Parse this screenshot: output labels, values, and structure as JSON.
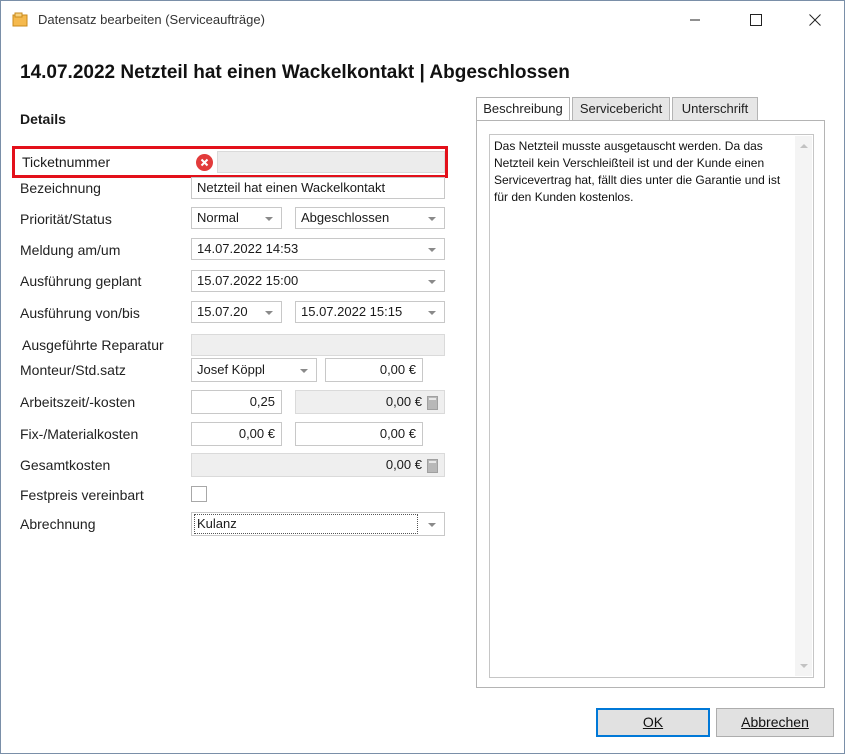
{
  "window": {
    "title": "Datensatz bearbeiten (Serviceaufträge)"
  },
  "headline": "14.07.2022 Netzteil hat einen Wackelkontakt | Abgeschlossen",
  "details": {
    "section_title": "Details",
    "ticket": {
      "label": "Ticketnummer",
      "value": ""
    },
    "bezeichnung": {
      "label": "Bezeichnung",
      "value": "Netzteil hat einen Wackelkontakt"
    },
    "prioritaet": {
      "label": "Priorität/Status",
      "priority": "Normal",
      "status": "Abgeschlossen"
    },
    "meldung": {
      "label": "Meldung am/um",
      "value": "14.07.2022 14:53"
    },
    "geplant": {
      "label": "Ausführung geplant",
      "value": "15.07.2022 15:00"
    },
    "von_bis": {
      "label": "Ausführung von/bis",
      "from": "15.07.20",
      "to": "15.07.2022 15:15"
    },
    "reparatur": {
      "label": "Ausgeführte Reparatur",
      "value": ""
    },
    "monteur": {
      "label": "Monteur/Std.satz",
      "name": "Josef Köppl",
      "rate": "0,00 €"
    },
    "arbeitszeit": {
      "label": "Arbeitszeit/-kosten",
      "hours": "0,25",
      "cost": "0,00 €"
    },
    "material": {
      "label": "Fix-/Materialkosten",
      "fix": "0,00 €",
      "material": "0,00 €"
    },
    "gesamt": {
      "label": "Gesamtkosten",
      "value": "0,00 €"
    },
    "festpreis": {
      "label": "Festpreis vereinbart",
      "checked": false
    },
    "abrechnung": {
      "label": "Abrechnung",
      "value": "Kulanz"
    }
  },
  "tabs": [
    {
      "label": "Beschreibung",
      "active": true
    },
    {
      "label": "Servicebericht",
      "active": false
    },
    {
      "label": "Unterschrift",
      "active": false
    }
  ],
  "description": "Das Netzteil musste ausgetauscht werden. Da das Netzteil kein Verschleißteil ist und der Kunde einen Servicevertrag hat, fällt dies unter die Garantie und ist für den Kunden kostenlos.",
  "buttons": {
    "ok": "OK",
    "cancel": "Abbrechen"
  },
  "colors": {
    "highlight": "#e3101a",
    "error_icon": "#e23b3b",
    "primary_button_border": "#0078d7"
  },
  "icons": [
    "app-icon",
    "minimize-icon",
    "maximize-icon",
    "close-icon",
    "error-icon",
    "dropdown-caret-icon",
    "calculator-icon"
  ]
}
